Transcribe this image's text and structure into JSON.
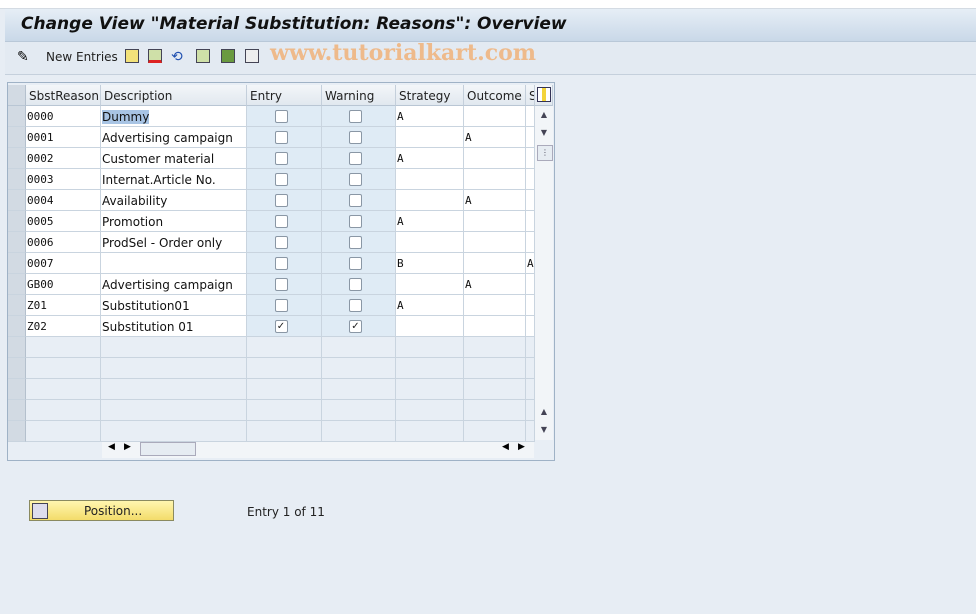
{
  "title": "Change View \"Material Substitution: Reasons\": Overview",
  "toolbar": {
    "new_entries": "New Entries",
    "watermark": "www.tutorialkart.com"
  },
  "columns": [
    "SbstReason",
    "Description",
    "Entry",
    "Warning",
    "Strategy",
    "Outcome",
    "S"
  ],
  "rows": [
    {
      "reason": "0000",
      "desc": "Dummy",
      "entry": false,
      "warning": false,
      "strategy": "A",
      "outcome": "",
      "s": ""
    },
    {
      "reason": "0001",
      "desc": "Advertising campaign",
      "entry": false,
      "warning": false,
      "strategy": "",
      "outcome": "A",
      "s": ""
    },
    {
      "reason": "0002",
      "desc": "Customer material",
      "entry": false,
      "warning": false,
      "strategy": "A",
      "outcome": "",
      "s": ""
    },
    {
      "reason": "0003",
      "desc": "Internat.Article No.",
      "entry": false,
      "warning": false,
      "strategy": "",
      "outcome": "",
      "s": ""
    },
    {
      "reason": "0004",
      "desc": "Availability",
      "entry": false,
      "warning": false,
      "strategy": "",
      "outcome": "A",
      "s": ""
    },
    {
      "reason": "0005",
      "desc": "Promotion",
      "entry": false,
      "warning": false,
      "strategy": "A",
      "outcome": "",
      "s": ""
    },
    {
      "reason": "0006",
      "desc": "ProdSel - Order only",
      "entry": false,
      "warning": false,
      "strategy": "",
      "outcome": "",
      "s": ""
    },
    {
      "reason": "0007",
      "desc": "",
      "entry": false,
      "warning": false,
      "strategy": "B",
      "outcome": "",
      "s": "A"
    },
    {
      "reason": "GB00",
      "desc": "Advertising campaign",
      "entry": false,
      "warning": false,
      "strategy": "",
      "outcome": "A",
      "s": ""
    },
    {
      "reason": "Z01",
      "desc": "Substitution01",
      "entry": false,
      "warning": false,
      "strategy": "A",
      "outcome": "",
      "s": ""
    },
    {
      "reason": "Z02",
      "desc": "Substitution 01",
      "entry": true,
      "warning": true,
      "strategy": "",
      "outcome": "",
      "s": ""
    }
  ],
  "empty_rows": 5,
  "position_button": "Position...",
  "entry_info": "Entry 1 of 11"
}
